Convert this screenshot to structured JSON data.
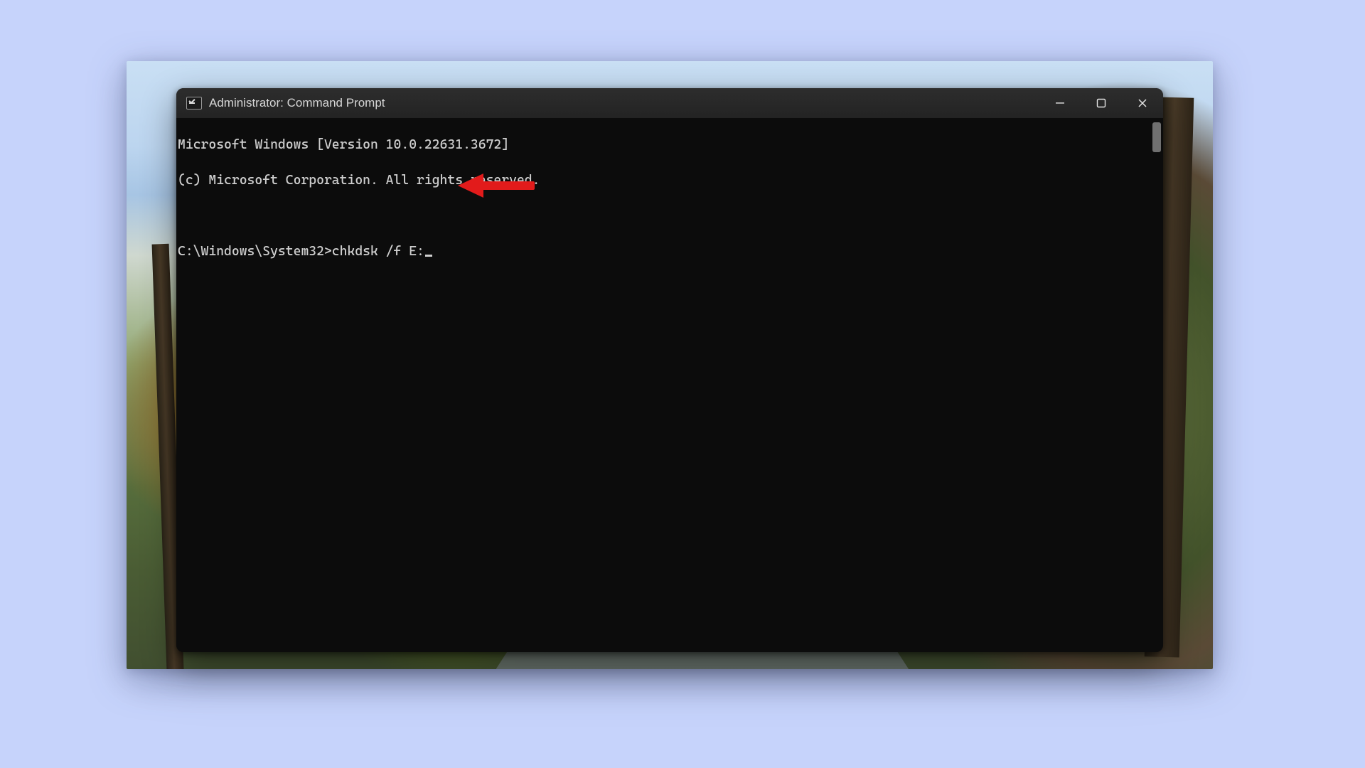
{
  "window": {
    "title": "Administrator: Command Prompt",
    "icon": "cmd-icon"
  },
  "terminal": {
    "banner1": "Microsoft Windows [Version 10.0.22631.3672]",
    "banner2": "(c) Microsoft Corporation. All rights reserved.",
    "prompt": "C:\\Windows\\System32>",
    "command": "chkdsk /f E:"
  },
  "annotation": {
    "type": "left-arrow",
    "color": "#e21b1b"
  }
}
